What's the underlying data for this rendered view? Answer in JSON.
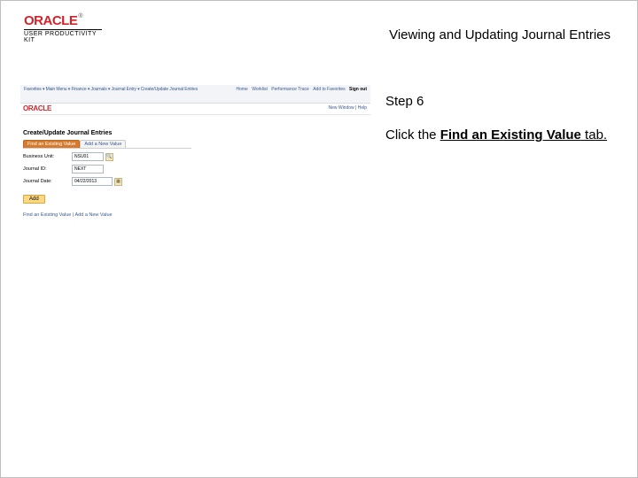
{
  "brand": {
    "logo_text": "ORACLE",
    "tm": "®",
    "kit_label": "USER PRODUCTIVITY KIT"
  },
  "header": {
    "title": "Viewing and Updating Journal Entries"
  },
  "instruction": {
    "step_label": "Step 6",
    "prefix": "Click the ",
    "tab_name": "Find an Existing Value",
    "suffix": " tab."
  },
  "mini": {
    "breadcrumb": "Favorites ▾   Main Menu ▾   Finance ▾   Journals ▾   Journal Entry ▾   Create/Update Journal Entries",
    "top_links": [
      "Home",
      "Worklist",
      "Performance Trace",
      "Add to Favorites"
    ],
    "signout": "Sign out",
    "logo": "ORACLE",
    "new_window": "New Window | Help",
    "page_title": "Create/Update Journal Entries",
    "tabs": {
      "active": "Find an Existing Value",
      "inactive": "Add a New Value"
    },
    "fields": {
      "bu_label": "Business Unit:",
      "bu_value": "NSU01",
      "jid_label": "Journal ID:",
      "jid_value": "NEXT",
      "jdate_label": "Journal Date:",
      "jdate_value": "04/22/2013"
    },
    "add_button": "Add",
    "footer_link": "Find an Existing Value | Add a New Value"
  }
}
